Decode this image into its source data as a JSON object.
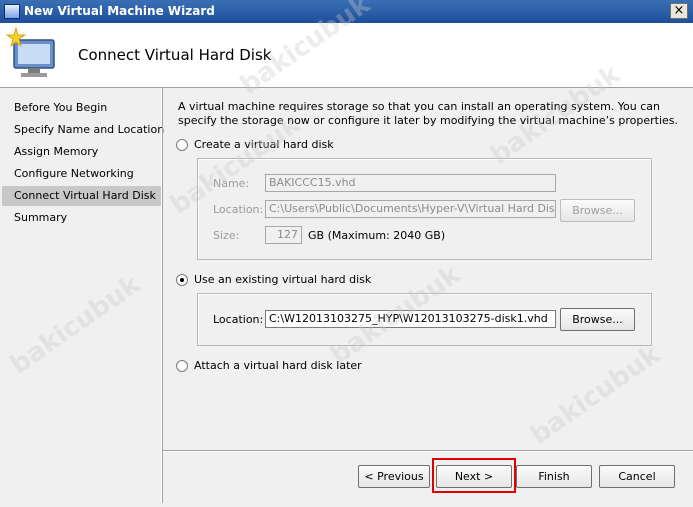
{
  "window": {
    "title": "New Virtual Machine Wizard",
    "close_glyph": "×"
  },
  "header": {
    "page_title": "Connect Virtual Hard Disk",
    "icon": "virtual-machine-wizard-icon"
  },
  "nav": {
    "items": [
      {
        "label": "Before You Begin",
        "active": false
      },
      {
        "label": "Specify Name and Location",
        "active": false
      },
      {
        "label": "Assign Memory",
        "active": false
      },
      {
        "label": "Configure Networking",
        "active": false
      },
      {
        "label": "Connect Virtual Hard Disk",
        "active": true
      },
      {
        "label": "Summary",
        "active": false
      }
    ]
  },
  "main": {
    "description": "A virtual machine requires storage so that you can install an operating system. You can specify the storage now or configure it later by modifying the virtual machine’s properties.",
    "create_option": {
      "label": "Create a virtual hard disk",
      "selected": false,
      "name_label": "Name:",
      "name_value": "BAKICCC15.vhd",
      "location_label": "Location:",
      "location_value": "C:\\Users\\Public\\Documents\\Hyper-V\\Virtual Hard Disks\\",
      "browse_label": "Browse...",
      "size_label": "Size:",
      "size_value": "127",
      "size_unit": "GB (Maximum: 2040 GB)"
    },
    "existing_option": {
      "label": "Use an existing virtual hard disk",
      "selected": true,
      "location_label": "Location:",
      "location_value": "C:\\W12013103275_HYP\\W12013103275-disk1.vhd",
      "browse_label": "Browse..."
    },
    "later_option": {
      "label": "Attach a virtual hard disk later",
      "selected": false
    }
  },
  "footer": {
    "previous_label": "< Previous",
    "next_label": "Next >",
    "finish_label": "Finish",
    "cancel_label": "Cancel"
  },
  "watermark": {
    "text": "bakicubuk"
  },
  "colors": {
    "titlebar": "#1d4f9a",
    "highlight": "#e00000",
    "active_nav": "#c8c8c8"
  }
}
